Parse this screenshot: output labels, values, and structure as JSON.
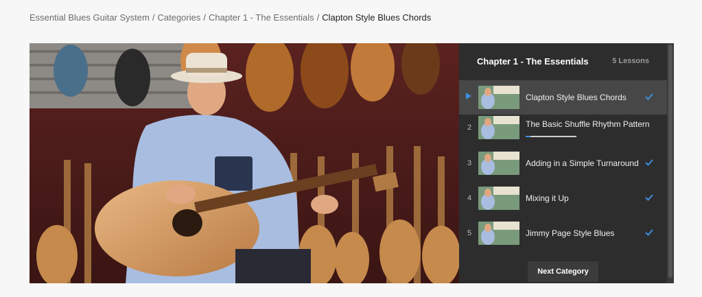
{
  "breadcrumb": {
    "items": [
      "Essential Blues Guitar System",
      "Categories",
      "Chapter 1 - The Essentials"
    ],
    "current": "Clapton Style Blues Chords",
    "separator": "/"
  },
  "playlist": {
    "title": "Chapter 1 - The Essentials",
    "count": "5 Lessons",
    "lessons": [
      {
        "number": "",
        "title": "Clapton Style Blues Chords",
        "active": true,
        "completed": true
      },
      {
        "number": "2",
        "title": "The Basic Shuffle Rhythm Pattern",
        "active": false,
        "completed": false,
        "progress": 0.1
      },
      {
        "number": "3",
        "title": "Adding in a Simple Turnaround",
        "active": false,
        "completed": true
      },
      {
        "number": "4",
        "title": "Mixing it Up",
        "active": false,
        "completed": true
      },
      {
        "number": "5",
        "title": "Jimmy Page Style Blues",
        "active": false,
        "completed": true
      }
    ],
    "next_button": "Next Category"
  },
  "colors": {
    "accent": "#3d8fe0",
    "panel": "#2d2d2d",
    "active_row": "#474747"
  },
  "icons": {
    "current": "play-indicator-icon",
    "completed": "checkmark-icon"
  }
}
